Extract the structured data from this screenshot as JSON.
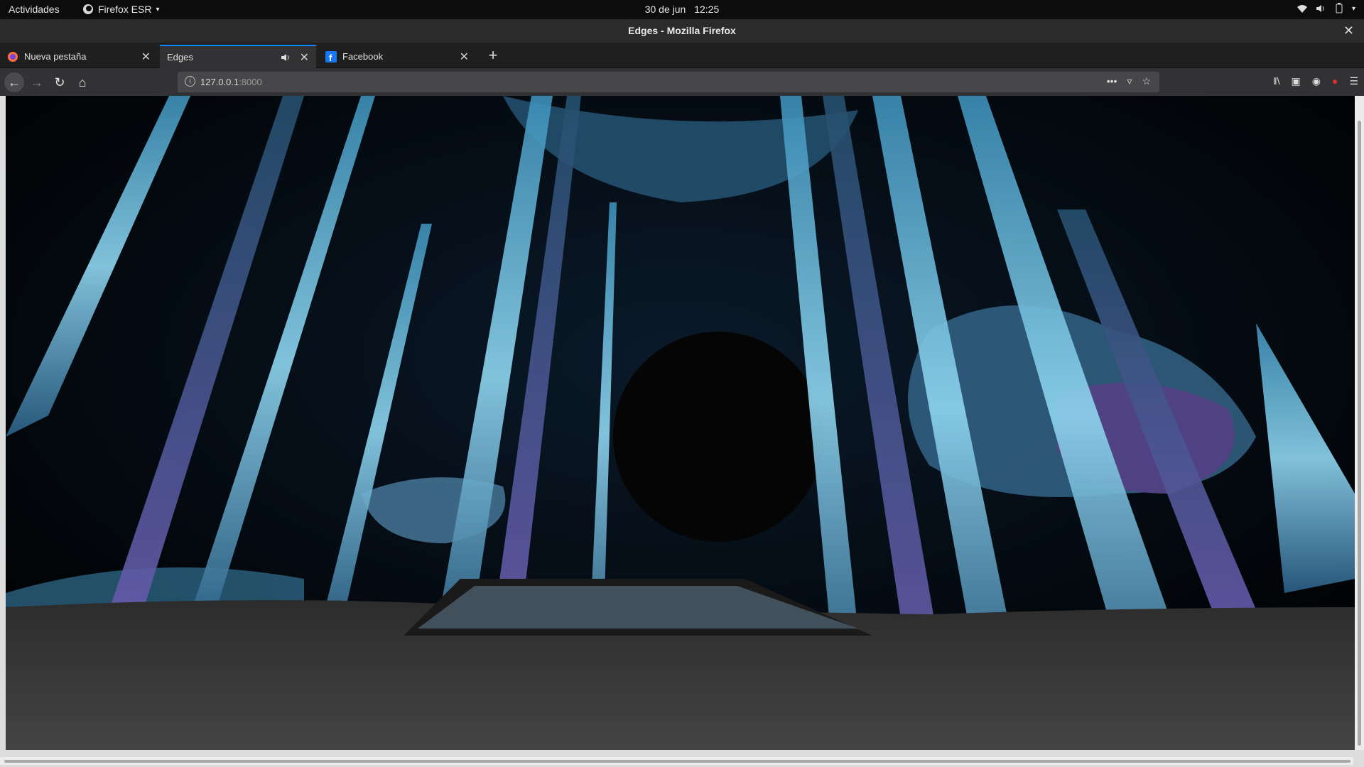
{
  "topbar": {
    "activities": "Actividades",
    "app_name": "Firefox ESR",
    "date": "30 de jun",
    "time": "12:25"
  },
  "window": {
    "title": "Edges - Mozilla Firefox"
  },
  "tabs": [
    {
      "label": "Nueva pestaña",
      "icon": "firefox-icon",
      "active": false
    },
    {
      "label": "Edges",
      "icon": "speaker-icon",
      "active": true
    },
    {
      "label": "Facebook",
      "icon": "facebook-icon",
      "active": false
    }
  ],
  "url": {
    "host": "127.0.0.1",
    "port": ":8000"
  },
  "scene": {
    "description_colors": {
      "background": "#000000",
      "accent": "#4fb3d9",
      "secondary": "#8a6fd0",
      "ground": "#3a3a3a"
    }
  }
}
